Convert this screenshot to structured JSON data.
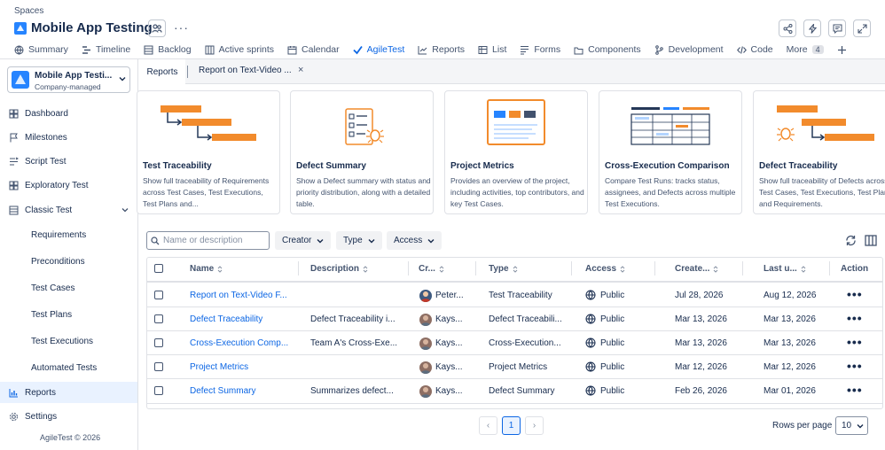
{
  "header": {
    "breadcrumb": "Spaces",
    "project_title": "Mobile App Testing",
    "more": "···"
  },
  "tabs": [
    {
      "label": "Summary",
      "icon": "globe-icon"
    },
    {
      "label": "Timeline",
      "icon": "timeline-icon"
    },
    {
      "label": "Backlog",
      "icon": "backlog-icon"
    },
    {
      "label": "Active sprints",
      "icon": "board-icon"
    },
    {
      "label": "Calendar",
      "icon": "calendar-icon"
    },
    {
      "label": "AgileTest",
      "icon": "agiletest-icon",
      "active": true
    },
    {
      "label": "Reports",
      "icon": "chart-icon"
    },
    {
      "label": "List",
      "icon": "list-icon"
    },
    {
      "label": "Forms",
      "icon": "forms-icon"
    },
    {
      "label": "Components",
      "icon": "components-icon"
    },
    {
      "label": "Development",
      "icon": "branch-icon"
    },
    {
      "label": "Code",
      "icon": "code-icon"
    }
  ],
  "more_tab": {
    "label": "More",
    "count": "4"
  },
  "sidebar": {
    "project_name": "Mobile App Testi...",
    "project_type": "Company-managed",
    "items": [
      {
        "label": "Dashboard"
      },
      {
        "label": "Milestones"
      },
      {
        "label": "Script Test"
      },
      {
        "label": "Exploratory Test"
      },
      {
        "label": "Classic Test"
      }
    ],
    "sub_items": [
      {
        "label": "Requirements"
      },
      {
        "label": "Preconditions"
      },
      {
        "label": "Test Cases"
      },
      {
        "label": "Test Plans"
      },
      {
        "label": "Test Executions"
      },
      {
        "label": "Automated Tests"
      }
    ],
    "reports": "Reports",
    "settings": "Settings",
    "footer": "AgileTest © 2026"
  },
  "report_tabs": {
    "reports": "Reports",
    "open_report": "Report on Text-Video ...",
    "close": "×"
  },
  "cards": [
    {
      "title": "Test Traceability",
      "desc": "Show full traceability of Requirements across Test Cases, Test Executions, Test Plans and..."
    },
    {
      "title": "Defect Summary",
      "desc": "Show a Defect summary with status and priority distribution, along with a detailed table."
    },
    {
      "title": "Project Metrics",
      "desc": "Provides an overview of the project, including activities, top contributors, and key Test Cases."
    },
    {
      "title": "Cross-Execution Comparison",
      "desc": "Compare Test Runs: tracks status, assignees, and Defects across multiple Test Executions."
    },
    {
      "title": "Defect Traceability",
      "desc": "Show full traceability of Defects across Test Cases, Test Executions, Test Plans and Requirements."
    }
  ],
  "filters": {
    "search_placeholder": "Name or description",
    "creator": "Creator",
    "type": "Type",
    "access": "Access"
  },
  "table": {
    "columns": [
      "Name",
      "Description",
      "Cr...",
      "Type",
      "Access",
      "Create...",
      "Last u...",
      "Action"
    ],
    "rows": [
      {
        "name": "Report on Text-Video F...",
        "description": "",
        "creator": "Peter...",
        "type": "Test Traceability",
        "access": "Public",
        "created": "Jul 28, 2026",
        "updated": "Aug 12, 2026"
      },
      {
        "name": "Defect Traceability",
        "description": "Defect Traceability i...",
        "creator": "Kays...",
        "type": "Defect Traceabili...",
        "access": "Public",
        "created": "Mar 13, 2026",
        "updated": "Mar 13, 2026"
      },
      {
        "name": "Cross-Execution Comp...",
        "description": "Team A's Cross-Exe...",
        "creator": "Kays...",
        "type": "Cross-Execution...",
        "access": "Public",
        "created": "Mar 13, 2026",
        "updated": "Mar 13, 2026"
      },
      {
        "name": "Project Metrics",
        "description": "",
        "creator": "Kays...",
        "type": "Project Metrics",
        "access": "Public",
        "created": "Mar 12, 2026",
        "updated": "Mar 12, 2026"
      },
      {
        "name": "Defect Summary",
        "description": "Summarizes defect...",
        "creator": "Kays...",
        "type": "Defect Summary",
        "access": "Public",
        "created": "Feb 26, 2026",
        "updated": "Mar 01, 2026"
      }
    ],
    "action_glyph": "•••"
  },
  "pagination": {
    "prev": "‹",
    "current": "1",
    "next": "›",
    "rows_label": "Rows per page",
    "rows_value": "10"
  },
  "colors": {
    "accent": "#0c66e4",
    "orange": "#f28b2c",
    "navy": "#253858"
  }
}
